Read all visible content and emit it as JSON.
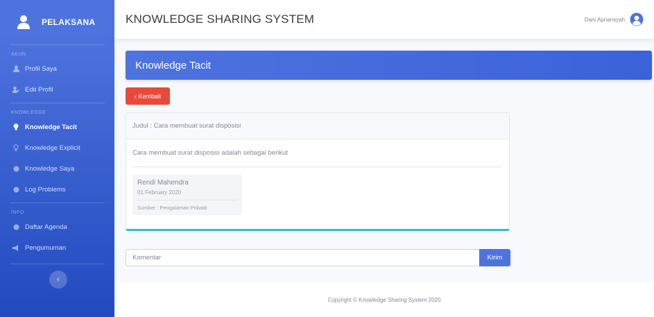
{
  "sidebar": {
    "brand": "PELAKSANA",
    "sections": [
      {
        "heading": "AKUN"
      },
      {
        "heading": "KNOWLEDGE"
      },
      {
        "heading": "INFO"
      }
    ],
    "items": [
      {
        "label": "Profil Saya",
        "icon": "user-icon"
      },
      {
        "label": "Edit Profil",
        "icon": "user-edit-icon"
      },
      {
        "label": "Knowledge Tacit",
        "icon": "lightbulb-icon",
        "active": true
      },
      {
        "label": "Knowledge Explicit",
        "icon": "lightbulb-outline-icon"
      },
      {
        "label": "Knowledge Saya",
        "icon": "circle-icon"
      },
      {
        "label": "Log Problems",
        "icon": "circle-icon"
      },
      {
        "label": "Daftar Agenda",
        "icon": "circle-icon"
      },
      {
        "label": "Pengumuman",
        "icon": "bullhorn-icon"
      }
    ]
  },
  "topbar": {
    "title": "KNOWLEDGE SHARING SYSTEM",
    "username": "Dani Apriansyah"
  },
  "page": {
    "heading": "Knowledge Tacit",
    "back_label": "‹ Kembali"
  },
  "card": {
    "title": "Judul : Cara membuat surat disposisi",
    "body": "Cara membuat surat disposisi adalah sebagai berikut",
    "author": {
      "name": "Rendi Mahendra",
      "date": "01 February 2020",
      "source": "Sumber : Pengalaman Pribadi"
    }
  },
  "comment": {
    "placeholder": "Komentar",
    "send_label": "Kirim"
  },
  "footer": {
    "text": "Copyright © Knowledge Sharing System 2020"
  },
  "colors": {
    "primary": "#4e73df",
    "danger": "#e74a3b",
    "info": "#36b9cc"
  }
}
